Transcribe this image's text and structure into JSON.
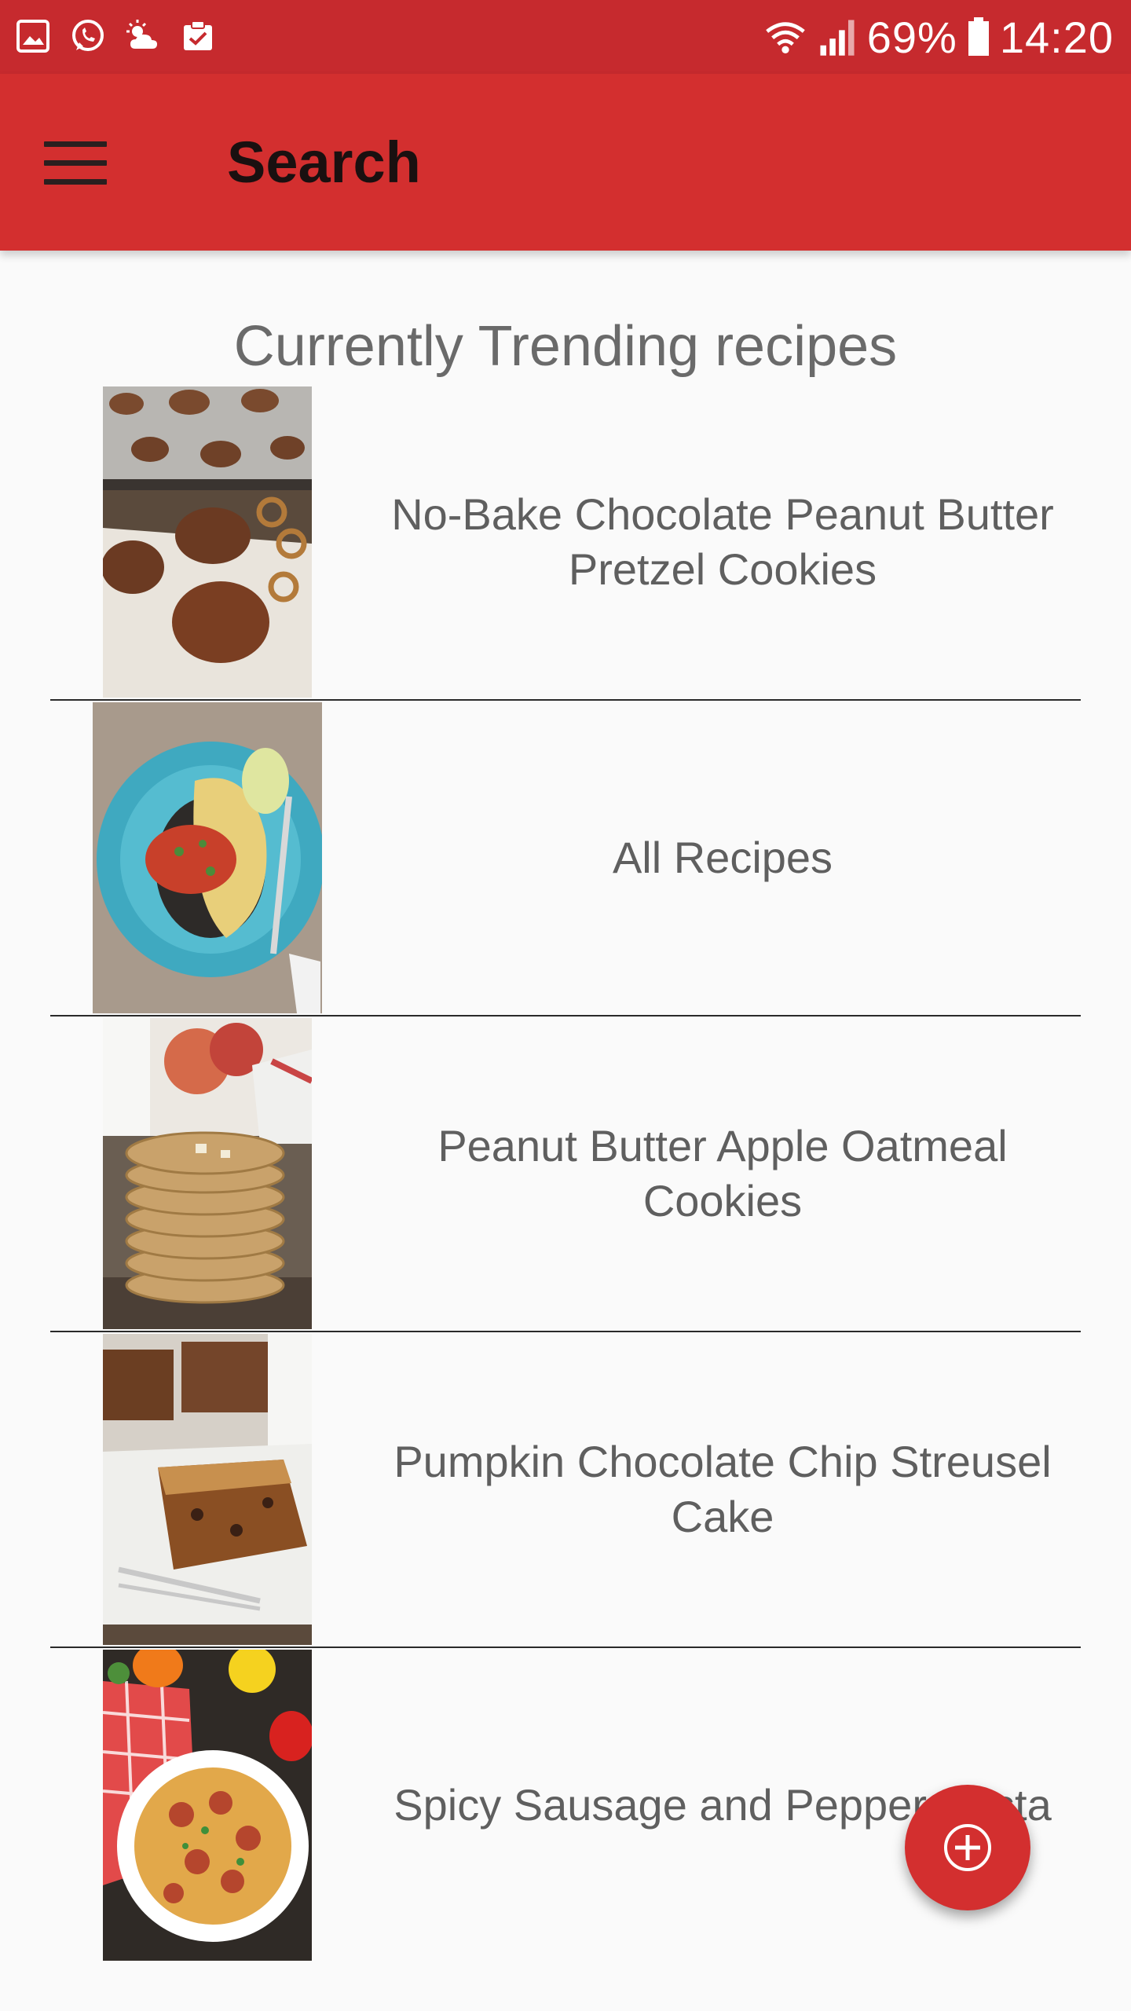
{
  "status_bar": {
    "battery": "69%",
    "time": "14:20",
    "icons_left": [
      "gallery-icon",
      "whatsapp-icon",
      "weather-icon",
      "clipboard-check-icon"
    ],
    "icons_right": [
      "wifi-icon",
      "signal-icon",
      "battery-icon"
    ]
  },
  "app_bar": {
    "title": "Search",
    "menu_icon": "hamburger-menu-icon",
    "color": "#d32f2f"
  },
  "section": {
    "title": "Currently Trending recipes"
  },
  "recipes": [
    {
      "title": "No-Bake Chocolate Peanut Butter Pretzel Cookies",
      "image": "chocolate-pretzel-cookies-photo"
    },
    {
      "title": "All Recipes",
      "image": "blue-plate-omelette-photo"
    },
    {
      "title": "Peanut Butter Apple Oatmeal Cookies",
      "image": "stacked-oatmeal-cookies-photo"
    },
    {
      "title": "Pumpkin Chocolate Chip Streusel Cake",
      "image": "streusel-cake-slice-photo"
    },
    {
      "title": "Spicy Sausage and Pepper Pasta",
      "image": "sausage-pepper-pasta-photo"
    }
  ],
  "fab": {
    "icon": "add-circle-icon",
    "color": "#d32f2f"
  }
}
